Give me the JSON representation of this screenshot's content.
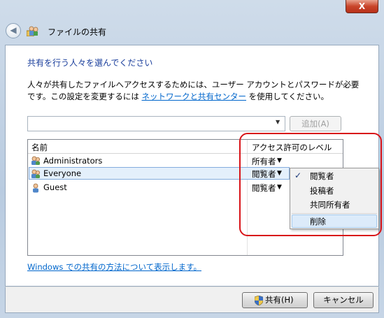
{
  "window": {
    "title": "ファイルの共有",
    "close_glyph": "X"
  },
  "content": {
    "heading": "共有を行う人々を選んでください",
    "desc_part1": "人々が共有したファイルへアクセスするためには、ユーザー アカウントとパスワードが必要です。この設定を変更するには ",
    "desc_link": "ネットワークと共有センター",
    "desc_part2": " を使用してください。",
    "combo_value": "",
    "add_button": "追加(A)"
  },
  "table": {
    "col_name": "名前",
    "col_permission": "アクセス許可のレベル",
    "rows": [
      {
        "name": "Administrators",
        "permission": "所有者"
      },
      {
        "name": "Everyone",
        "permission": "閲覧者"
      },
      {
        "name": "Guest",
        "permission": "閲覧者"
      }
    ]
  },
  "menu": {
    "items": [
      "閲覧者",
      "投稿者",
      "共同所有者",
      "削除"
    ],
    "checked": "閲覧者",
    "highlighted": "削除"
  },
  "help_link": "Windows での共有の方法について表示します。",
  "footer": {
    "share_button": "共有(H)",
    "cancel_button": "キャンセル"
  },
  "colors": {
    "link": "#0066cc",
    "heading": "#1a3e9c",
    "highlight_box": "#d81318"
  }
}
